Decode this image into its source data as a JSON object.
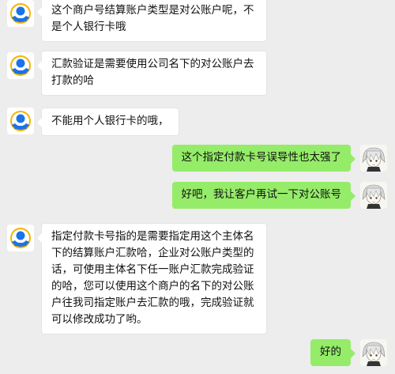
{
  "colors": {
    "background": "#ededed",
    "received_bubble": "#ffffff",
    "sent_bubble": "#95ec69"
  },
  "messages": [
    {
      "sender": "other",
      "avatar": "support-avatar-icon",
      "text": "这个商户号结算账户类型是对公账户呢，不是个人银行卡哦"
    },
    {
      "sender": "other",
      "avatar": "support-avatar-icon",
      "text": "汇款验证是需要使用公司名下的对公账户去打款的哈"
    },
    {
      "sender": "other",
      "avatar": "support-avatar-icon",
      "text": "不能用个人银行卡的哦，"
    },
    {
      "sender": "me",
      "avatar": "user-avatar-icon",
      "text": "这个指定付款卡号误导性也太强了"
    },
    {
      "sender": "me",
      "avatar": "user-avatar-icon",
      "text": "好吧，我让客户再试一下对公账号"
    },
    {
      "sender": "other",
      "avatar": "support-avatar-icon",
      "text": "指定付款卡号指的是需要指定用这个主体名下的结算账户汇款哈，企业对公账户类型的话，可使用主体名下任一账户汇款完成验证的哈，您可以使用这个商户的名下的对公账户往我司指定账户去汇款的哦，完成验证就可以修改成功了哟。"
    },
    {
      "sender": "me",
      "avatar": "user-avatar-icon",
      "text": "好的"
    }
  ]
}
